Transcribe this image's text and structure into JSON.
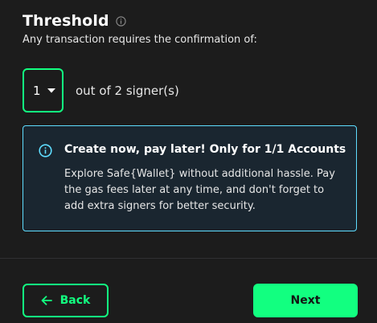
{
  "header": {
    "title": "Threshold",
    "subtitle": "Any transaction requires the confirmation of:"
  },
  "threshold": {
    "selected": "1",
    "out_of_text": "out of 2 signer(s)"
  },
  "notice": {
    "heading": "Create now, pay later! Only for 1/1 Accounts",
    "body": "Explore Safe{Wallet} without additional hassle. Pay the gas fees later at any time, and don't forget to add extra signers for better security."
  },
  "footer": {
    "back_label": "Back",
    "next_label": "Next"
  },
  "colors": {
    "accent": "#12ff80",
    "info_border": "#5fddff",
    "info_bg": "#1a2630",
    "background": "#1c1c1c"
  },
  "icons": {
    "title_info": "info-icon",
    "select_caret": "caret-down-icon",
    "notice_info": "info-icon",
    "back_arrow": "arrow-left-icon"
  }
}
